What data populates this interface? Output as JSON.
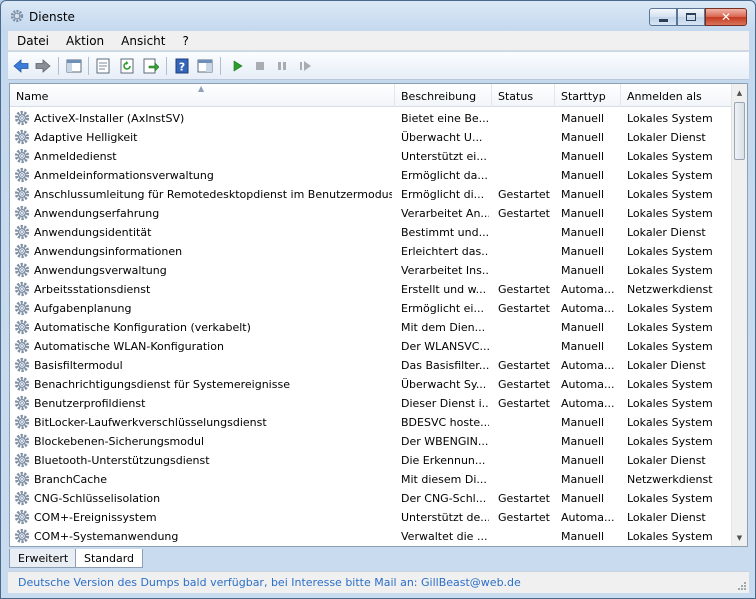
{
  "window": {
    "title": "Dienste",
    "icon": "gear-icon"
  },
  "caption": {
    "minimize": "minimize-icon",
    "maximize": "maximize-icon",
    "close": "✕"
  },
  "menu": [
    "Datei",
    "Aktion",
    "Ansicht",
    "?"
  ],
  "toolbar": {
    "icons": [
      "back-arrow-icon",
      "forward-arrow-icon",
      "console-tree-icon",
      "properties-icon",
      "refresh-icon",
      "export-list-icon",
      "help-icon",
      "show-pane-icon",
      "start-icon",
      "stop-icon",
      "pause-icon",
      "restart-icon"
    ]
  },
  "columns": {
    "name": "Name",
    "description": "Beschreibung",
    "status": "Status",
    "starttype": "Starttyp",
    "logon": "Anmelden als"
  },
  "services": [
    {
      "name": "ActiveX-Installer (AxInstSV)",
      "description": "Bietet eine Be...",
      "status": "",
      "starttype": "Manuell",
      "logon": "Lokales System"
    },
    {
      "name": "Adaptive Helligkeit",
      "description": "Überwacht U...",
      "status": "",
      "starttype": "Manuell",
      "logon": "Lokaler Dienst"
    },
    {
      "name": "Anmeldedienst",
      "description": "Unterstützt ei...",
      "status": "",
      "starttype": "Manuell",
      "logon": "Lokales System"
    },
    {
      "name": "Anmeldeinformationsverwaltung",
      "description": "Ermöglicht da...",
      "status": "",
      "starttype": "Manuell",
      "logon": "Lokales System"
    },
    {
      "name": "Anschlussumleitung für Remotedesktopdienst im Benutzermodus",
      "description": "Ermöglicht di...",
      "status": "Gestartet",
      "starttype": "Manuell",
      "logon": "Lokales System"
    },
    {
      "name": "Anwendungserfahrung",
      "description": "Verarbeitet An...",
      "status": "Gestartet",
      "starttype": "Manuell",
      "logon": "Lokales System"
    },
    {
      "name": "Anwendungsidentität",
      "description": "Bestimmt und...",
      "status": "",
      "starttype": "Manuell",
      "logon": "Lokaler Dienst"
    },
    {
      "name": "Anwendungsinformationen",
      "description": "Erleichtert das...",
      "status": "",
      "starttype": "Manuell",
      "logon": "Lokales System"
    },
    {
      "name": "Anwendungsverwaltung",
      "description": "Verarbeitet Ins...",
      "status": "",
      "starttype": "Manuell",
      "logon": "Lokales System"
    },
    {
      "name": "Arbeitsstationsdienst",
      "description": "Erstellt und w...",
      "status": "Gestartet",
      "starttype": "Automa...",
      "logon": "Netzwerkdienst"
    },
    {
      "name": "Aufgabenplanung",
      "description": "Ermöglicht ei...",
      "status": "Gestartet",
      "starttype": "Automa...",
      "logon": "Lokales System"
    },
    {
      "name": "Automatische Konfiguration (verkabelt)",
      "description": "Mit dem Dien...",
      "status": "",
      "starttype": "Manuell",
      "logon": "Lokales System"
    },
    {
      "name": "Automatische WLAN-Konfiguration",
      "description": "Der WLANSVC...",
      "status": "",
      "starttype": "Manuell",
      "logon": "Lokales System"
    },
    {
      "name": "Basisfiltermodul",
      "description": "Das Basisfilter...",
      "status": "Gestartet",
      "starttype": "Automa...",
      "logon": "Lokaler Dienst"
    },
    {
      "name": "Benachrichtigungsdienst für Systemereignisse",
      "description": "Überwacht Sy...",
      "status": "Gestartet",
      "starttype": "Automa...",
      "logon": "Lokales System"
    },
    {
      "name": "Benutzerprofildienst",
      "description": "Dieser Dienst i...",
      "status": "Gestartet",
      "starttype": "Automa...",
      "logon": "Lokales System"
    },
    {
      "name": "BitLocker-Laufwerkverschlüsselungsdienst",
      "description": "BDESVC hoste...",
      "status": "",
      "starttype": "Manuell",
      "logon": "Lokales System"
    },
    {
      "name": "Blockebenen-Sicherungsmodul",
      "description": "Der WBENGIN...",
      "status": "",
      "starttype": "Manuell",
      "logon": "Lokales System"
    },
    {
      "name": "Bluetooth-Unterstützungsdienst",
      "description": "Die Erkennun...",
      "status": "",
      "starttype": "Manuell",
      "logon": "Lokaler Dienst"
    },
    {
      "name": "BranchCache",
      "description": "Mit diesem Di...",
      "status": "",
      "starttype": "Manuell",
      "logon": "Netzwerkdienst"
    },
    {
      "name": "CNG-Schlüsselisolation",
      "description": "Der CNG-Schl...",
      "status": "Gestartet",
      "starttype": "Manuell",
      "logon": "Lokales System"
    },
    {
      "name": "COM+-Ereignissystem",
      "description": "Unterstützt de...",
      "status": "Gestartet",
      "starttype": "Automa...",
      "logon": "Lokaler Dienst"
    },
    {
      "name": "COM+-Systemanwendung",
      "description": "Verwaltet die ...",
      "status": "",
      "starttype": "Manuell",
      "logon": "Lokales System"
    }
  ],
  "tabs": [
    {
      "label": "Erweitert",
      "active": false
    },
    {
      "label": "Standard",
      "active": true
    }
  ],
  "statusbar": {
    "text": "Deutsche Version des Dumps bald verfügbar, bei Interesse bitte Mail an: GillBeast@web.de"
  }
}
